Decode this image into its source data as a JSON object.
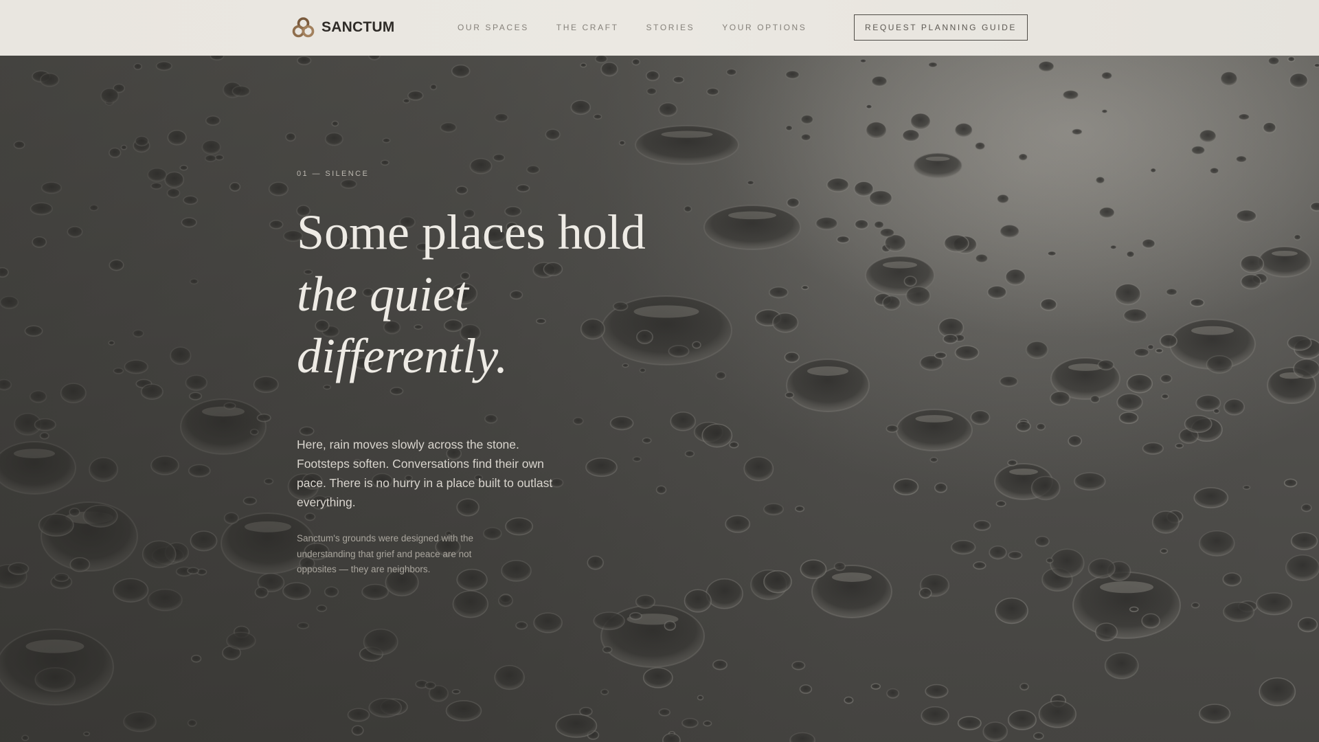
{
  "header": {
    "brand": "SANCTUM",
    "nav": [
      {
        "label": "OUR SPACES"
      },
      {
        "label": "THE CRAFT"
      },
      {
        "label": "STORIES"
      },
      {
        "label": "YOUR OPTIONS"
      }
    ],
    "cta_label": "REQUEST PLANNING GUIDE"
  },
  "hero": {
    "eyebrow": "01 — SILENCE",
    "headline_line1": "Some places hold",
    "headline_line2": "the quiet",
    "headline_line3": "differently.",
    "lead": "Here, rain moves slowly across the stone. Footsteps soften. Conversations find their own pace. There is no hurry in a place built to outlast everything.",
    "note": "Sanctum's grounds were designed with the understanding that grief and peace are not opposites — they are neighbors."
  },
  "colors": {
    "header_bg": "#ebe8e2",
    "brand_text": "#2e2b27",
    "nav_text": "#85817a",
    "logo_accent": "#8a6a48",
    "hero_text": "#eeebe5"
  },
  "icons": {
    "logo": "three-ring-knot-icon"
  }
}
